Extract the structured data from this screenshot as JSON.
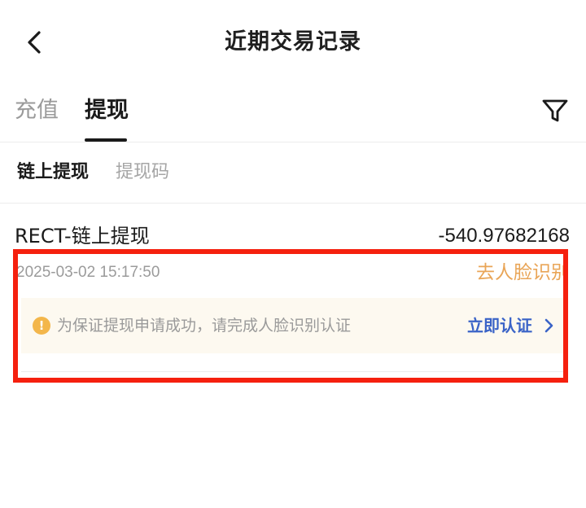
{
  "header": {
    "title": "近期交易记录",
    "back_icon": "chevron-left-icon"
  },
  "tabs": [
    {
      "label": "充值",
      "active": false
    },
    {
      "label": "提现",
      "active": true
    }
  ],
  "filter_icon": "filter-icon",
  "subtabs": [
    {
      "label": "链上提现",
      "active": true
    },
    {
      "label": "提现码",
      "active": false
    }
  ],
  "record": {
    "name": "RECT-链上提现",
    "amount": "-540.97682168",
    "time": "2025-03-02 15:17:50",
    "status": "去人脸识别",
    "notice": {
      "icon": "info-icon",
      "text": "为保证提现申请成功，请完成人脸识别认证",
      "action": "立即认证"
    }
  },
  "colors": {
    "status_orange": "#e9a557",
    "action_blue": "#3a63c7",
    "highlight_red": "#f5200e",
    "notice_bg": "#fdf9f0"
  }
}
